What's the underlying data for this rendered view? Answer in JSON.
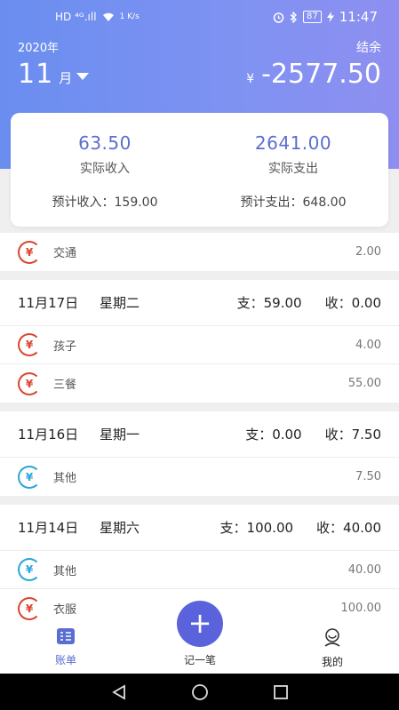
{
  "status": {
    "left_indicators": "HD ⁴ᴳ.ıll",
    "speed": "1 K/s",
    "battery": "87",
    "time": "11:47"
  },
  "header": {
    "year": "2020年",
    "month": "11",
    "month_unit": "月",
    "surplus_label": "结余",
    "currency": "¥",
    "balance": "-2577.50"
  },
  "summary": {
    "actual_income": "63.50",
    "actual_income_label": "实际收入",
    "actual_expense": "2641.00",
    "actual_expense_label": "实际支出",
    "est_income": "预计收入：159.00",
    "est_expense": "预计支出：648.00"
  },
  "partial_entry": {
    "name": "交通",
    "amount": "2.00",
    "type": "out"
  },
  "days": [
    {
      "date": "11月17日",
      "weekday": "星期二",
      "pay": "支：59.00",
      "recv": "收：0.00",
      "entries": [
        {
          "name": "孩子",
          "amount": "4.00",
          "type": "out"
        },
        {
          "name": "三餐",
          "amount": "55.00",
          "type": "out"
        }
      ]
    },
    {
      "date": "11月16日",
      "weekday": "星期一",
      "pay": "支：0.00",
      "recv": "收：7.50",
      "entries": [
        {
          "name": "其他",
          "amount": "7.50",
          "type": "in"
        }
      ]
    },
    {
      "date": "11月14日",
      "weekday": "星期六",
      "pay": "支：100.00",
      "recv": "收：40.00",
      "entries": [
        {
          "name": "其他",
          "amount": "40.00",
          "type": "in"
        },
        {
          "name": "衣服",
          "amount": "100.00",
          "type": "out"
        }
      ]
    }
  ],
  "nav": {
    "bill": "账单",
    "add": "记一笔",
    "add_symbol": "+",
    "mine": "我的"
  },
  "icons": {
    "expense_icon": "¥",
    "income_icon": "¥"
  },
  "colors": {
    "accent": "#5b6ed0",
    "expense": "#d9452e",
    "income": "#2aa6d8"
  }
}
